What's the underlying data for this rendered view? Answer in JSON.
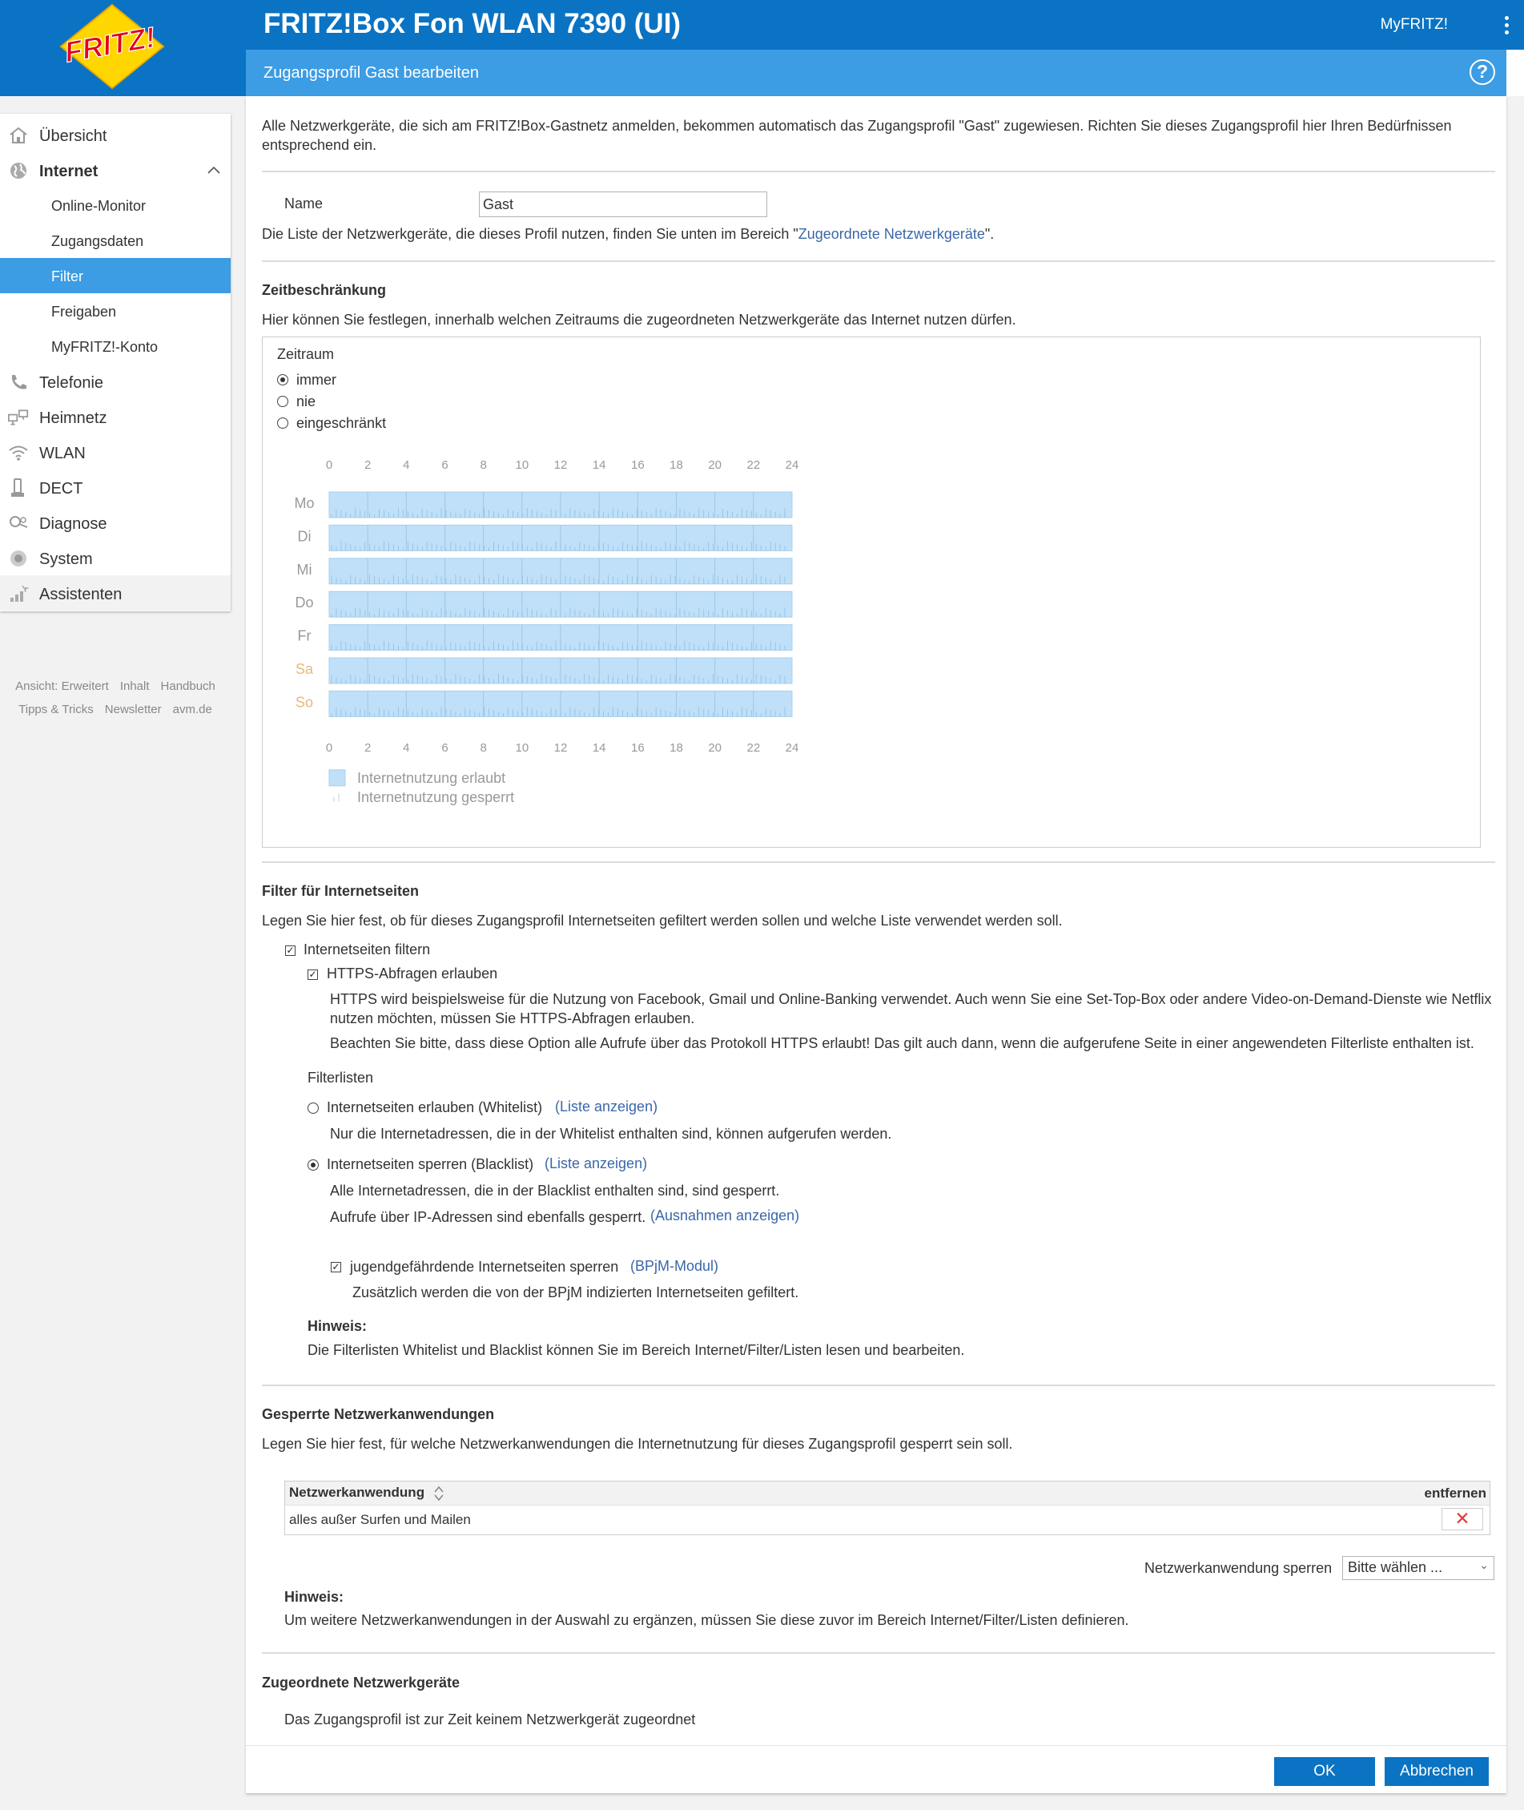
{
  "header": {
    "app_title": "FRITZ!Box Fon WLAN 7390 (UI)",
    "myfritz": "MyFRITZ!",
    "subtitle": "Zugangsprofil Gast bearbeiten",
    "help": "?",
    "logo_text": "FRITZ!"
  },
  "sidebar": {
    "items": [
      {
        "label": "Übersicht",
        "icon": "home-icon"
      },
      {
        "label": "Internet",
        "icon": "globe-icon"
      },
      {
        "label": "Online-Monitor"
      },
      {
        "label": "Zugangsdaten"
      },
      {
        "label": "Filter"
      },
      {
        "label": "Freigaben"
      },
      {
        "label": "MyFRITZ!-Konto"
      },
      {
        "label": "Telefonie",
        "icon": "phone-icon"
      },
      {
        "label": "Heimnetz",
        "icon": "network-icon"
      },
      {
        "label": "WLAN",
        "icon": "wifi-icon"
      },
      {
        "label": "DECT",
        "icon": "dect-icon"
      },
      {
        "label": "Diagnose",
        "icon": "diagnose-icon"
      },
      {
        "label": "System",
        "icon": "system-icon"
      },
      {
        "label": "Assistenten",
        "icon": "wizard-icon"
      }
    ],
    "footer": [
      "Ansicht: Erweitert",
      "Inhalt",
      "Handbuch",
      "Tipps & Tricks",
      "Newsletter",
      "avm.de"
    ]
  },
  "intro": {
    "line1": "Alle Netzwerkgeräte, die sich am FRITZ!Box-Gastnetz anmelden, bekommen automatisch das Zugangsprofil \"Gast\" zugewiesen. Richten Sie dieses Zugangsprofil hier Ihren Bedürfnissen",
    "line2": "entsprechend ein."
  },
  "name_field": {
    "label": "Name",
    "value": "Gast",
    "note_pre": "Die Liste der Netzwerkgeräte, die dieses Profil nutzen, finden Sie unten im Bereich \"",
    "note_link": "Zugeordnete Netzwerkgeräte",
    "note_post": "\"."
  },
  "zeit": {
    "heading": "Zeitbeschränkung",
    "desc": "Hier können Sie festlegen, innerhalb welchen Zeitraums die zugeordneten Netzwerkgeräte das Internet nutzen dürfen.",
    "zeitraum_label": "Zeitraum",
    "options": [
      {
        "label": "immer",
        "selected": true
      },
      {
        "label": "nie",
        "selected": false
      },
      {
        "label": "eingeschränkt",
        "selected": false
      }
    ],
    "hours": [
      "0",
      "2",
      "4",
      "6",
      "8",
      "10",
      "12",
      "14",
      "16",
      "18",
      "20",
      "22",
      "24"
    ],
    "days": [
      {
        "label": "Mo",
        "weekend": false
      },
      {
        "label": "Di",
        "weekend": false
      },
      {
        "label": "Mi",
        "weekend": false
      },
      {
        "label": "Do",
        "weekend": false
      },
      {
        "label": "Fr",
        "weekend": false
      },
      {
        "label": "Sa",
        "weekend": true
      },
      {
        "label": "So",
        "weekend": true
      }
    ],
    "legend_allowed": "Internetnutzung erlaubt",
    "legend_blocked": "Internetnutzung gesperrt",
    "allowed_color": "#bfe0f8",
    "weekend_color": "#e8b878"
  },
  "filter": {
    "heading": "Filter für Internetseiten",
    "desc": "Legen Sie hier fest, ob für dieses Zugangsprofil Internetseiten gefiltert werden sollen und welche Liste verwendet werden soll.",
    "filter_checkbox": "Internetseiten filtern",
    "https_checkbox": "HTTPS-Abfragen erlauben",
    "https_desc1": "HTTPS wird beispielsweise für die Nutzung von Facebook, Gmail und Online-Banking verwendet. Auch wenn Sie eine Set-Top-Box oder andere Video-on-Demand-Dienste wie Netflix",
    "https_desc2": "nutzen möchten, müssen Sie HTTPS-Abfragen erlauben.",
    "https_desc3": "Beachten Sie bitte, dass diese Option alle Aufrufe über das Protokoll HTTPS erlaubt! Das gilt auch dann, wenn die aufgerufene Seite in einer angewendeten Filterliste enthalten ist.",
    "filterlisten": "Filterlisten",
    "whitelist_label": "Internetseiten erlauben (Whitelist)",
    "whitelist_link": "(Liste anzeigen)",
    "whitelist_desc": "Nur die Internetadressen, die in der Whitelist enthalten sind, können aufgerufen werden.",
    "blacklist_label": "Internetseiten sperren (Blacklist)",
    "blacklist_link": "(Liste anzeigen)",
    "blacklist_desc1": "Alle Internetadressen, die in der Blacklist enthalten sind, sind gesperrt.",
    "blacklist_desc2": "Aufrufe über IP-Adressen sind ebenfalls gesperrt.",
    "ausnahmen_link": "(Ausnahmen anzeigen)",
    "bpjm_label": "jugendgefährdende Internetseiten sperren",
    "bpjm_link": "(BPjM-Modul)",
    "bpjm_desc": "Zusätzlich werden die von der BPjM indizierten Internetseiten gefiltert.",
    "hint_title": "Hinweis:",
    "hint_text": "Die Filterlisten Whitelist und Blacklist können Sie im Bereich Internet/Filter/Listen lesen und bearbeiten."
  },
  "apps": {
    "heading": "Gesperrte Netzwerkanwendungen",
    "desc": "Legen Sie hier fest, für welche Netzwerkanwendungen die Internetnutzung für dieses Zugangsprofil gesperrt sein soll.",
    "col_app": "Netzwerkanwendung",
    "col_remove": "entfernen",
    "rows": [
      {
        "app": "alles außer Surfen und Mailen"
      }
    ],
    "select_label": "Netzwerkanwendung sperren",
    "select_value": "Bitte wählen ...",
    "hint_title": "Hinweis:",
    "hint_text": "Um weitere Netzwerkanwendungen in der Auswahl zu ergänzen, müssen Sie diese zuvor im Bereich Internet/Filter/Listen definieren."
  },
  "devices": {
    "heading": "Zugeordnete Netzwerkgeräte",
    "text": "Das Zugangsprofil ist zur Zeit keinem Netzwerkgerät zugeordnet"
  },
  "buttons": {
    "ok": "OK",
    "cancel": "Abbrechen"
  },
  "colors": {
    "primary": "#0a73c3",
    "secondary": "#3c9ce4",
    "link": "#3a67a8"
  }
}
